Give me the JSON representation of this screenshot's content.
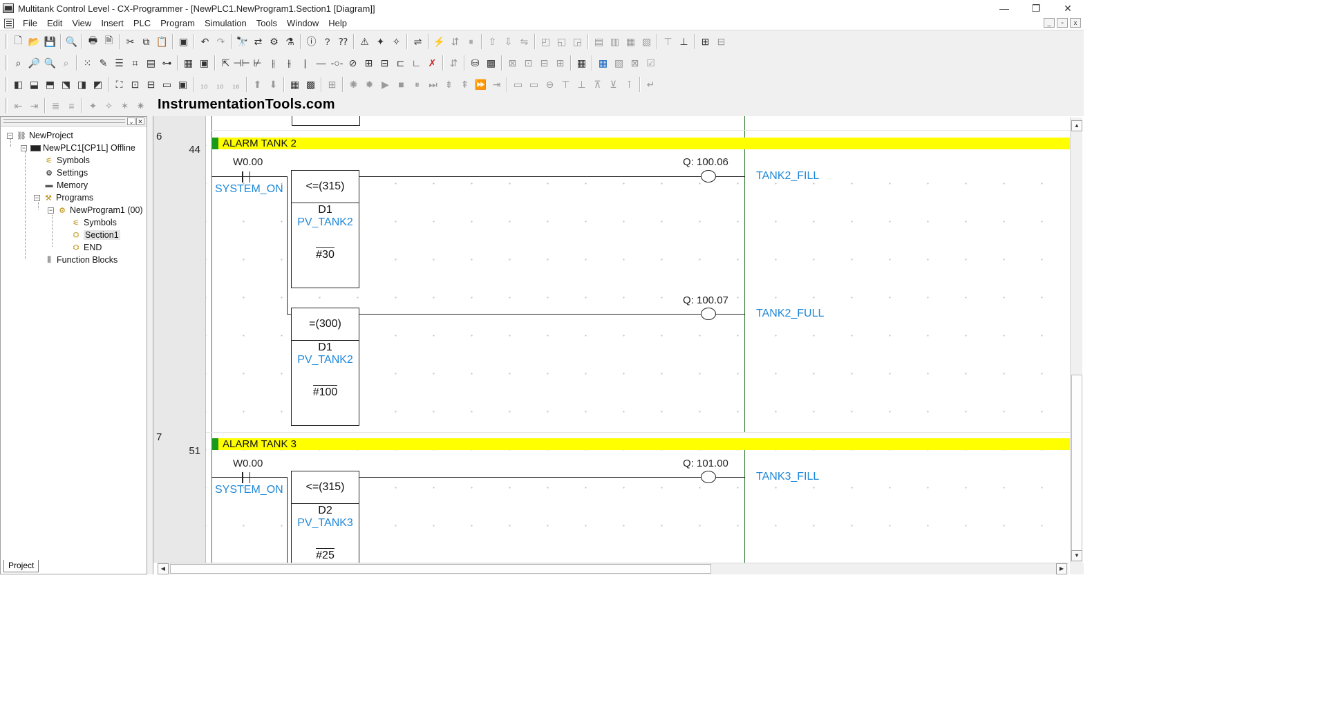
{
  "window": {
    "title": "Multitank Control Level - CX-Programmer - [NewPLC1.NewProgram1.Section1 [Diagram]]",
    "controls": [
      "—",
      "❐",
      "✕"
    ]
  },
  "menu": {
    "items": [
      "File",
      "Edit",
      "View",
      "Insert",
      "PLC",
      "Program",
      "Simulation",
      "Tools",
      "Window",
      "Help"
    ],
    "mdi_controls": [
      "_",
      "▫",
      "x"
    ]
  },
  "watermark": "InstrumentationTools.com",
  "project_tree": {
    "root": "NewProject",
    "plc": "NewPLC1[CP1L] Offline",
    "symbols": "Symbols",
    "settings": "Settings",
    "memory": "Memory",
    "programs": "Programs",
    "program": "NewProgram1 (00)",
    "program_symbols": "Symbols",
    "section": "Section1",
    "end": "END",
    "function_blocks": "Function Blocks",
    "tab": "Project"
  },
  "ladder": {
    "rung6": {
      "rung_number": "6",
      "step": "44",
      "comment": "ALARM TANK 2",
      "contact_address": "W0.00",
      "contact_symbol": "SYSTEM_ON",
      "block1": {
        "op": "<=(315)",
        "operand": "D1",
        "symbol": "PV_TANK2",
        "constant": "#30"
      },
      "block2": {
        "op": "=(300)",
        "operand": "D1",
        "symbol": "PV_TANK2",
        "constant": "#100"
      },
      "coil1_address": "Q: 100.06",
      "coil1_symbol": "TANK2_FILL",
      "coil2_address": "Q: 100.07",
      "coil2_symbol": "TANK2_FULL"
    },
    "rung7": {
      "rung_number": "7",
      "step": "51",
      "comment": "ALARM TANK 3",
      "contact_address": "W0.00",
      "contact_symbol": "SYSTEM_ON",
      "block1": {
        "op": "<=(315)",
        "operand": "D2",
        "symbol": "PV_TANK3",
        "constant": "#25"
      },
      "coil1_address": "Q: 101.00",
      "coil1_symbol": "TANK3_FILL"
    }
  },
  "colors": {
    "comment_bar": "#ffff00",
    "comment_marker": "#1a9a1a",
    "symbol_text": "#1e88d8",
    "power_rail": "#2e7d32"
  }
}
